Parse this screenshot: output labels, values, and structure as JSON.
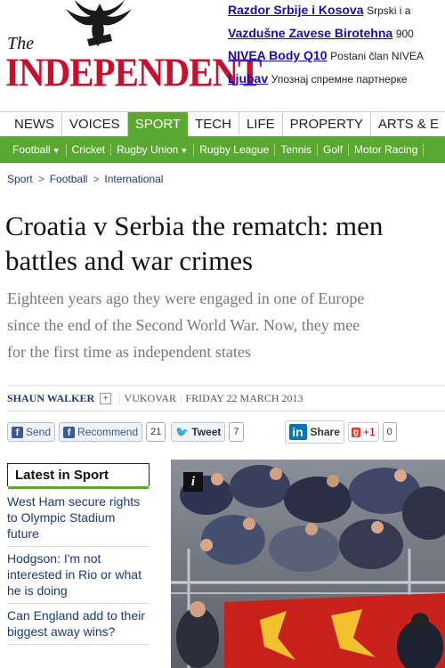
{
  "brand": {
    "the": "The",
    "name": "INDEPENDENT"
  },
  "ads": [
    {
      "link": "Razdor Srbije i Kosova",
      "text": "Srpski i a"
    },
    {
      "link": "Vazdušne Zavese Birotehna",
      "text": "900"
    },
    {
      "link": "NIVEA Body Q10",
      "text": "Postani član NIVEA"
    },
    {
      "link": "Ljubav",
      "text": "Упознај спремне партнерке"
    }
  ],
  "nav": [
    "NEWS",
    "VOICES",
    "SPORT",
    "TECH",
    "LIFE",
    "PROPERTY",
    "ARTS & E"
  ],
  "nav_active": "SPORT",
  "subnav": [
    "Football",
    "Cricket",
    "Rugby Union",
    "Rugby League",
    "Tennis",
    "Golf",
    "Motor Racing"
  ],
  "breadcrumb": [
    "Sport",
    "Football",
    "International"
  ],
  "article": {
    "headline_line1": "Croatia v Serbia the rematch: men",
    "headline_line2": "battles and war crimes",
    "standfirst_line1": "Eighteen years ago they were engaged in one of Europe",
    "standfirst_line2": "since the end of the Second World War. Now, they mee",
    "standfirst_line3": "for the first time as independent states"
  },
  "byline": {
    "author": "SHAUN WALKER",
    "plus": "+",
    "location": "VUKOVAR",
    "date": "FRIDAY 22 MARCH 2013"
  },
  "social": {
    "send": "Send",
    "recommend": "Recommend",
    "recommend_count": "21",
    "tweet": "Tweet",
    "tweet_count": "7",
    "linkedin": "in",
    "share": "Share",
    "gplus": "+1",
    "gplus_count": "0"
  },
  "sidebar": {
    "title": "Latest in Sport",
    "stories": [
      "West Ham secure rights to Olympic Stadium future",
      "Hodgson: I'm not interested in Rio or what he is doing",
      "Can England add to their biggest away wins?"
    ]
  },
  "photo": {
    "badge": "i"
  },
  "colors": {
    "brand_red": "#c8102e",
    "sport_green": "#5aa832",
    "link_blue": "#1a0dab"
  }
}
